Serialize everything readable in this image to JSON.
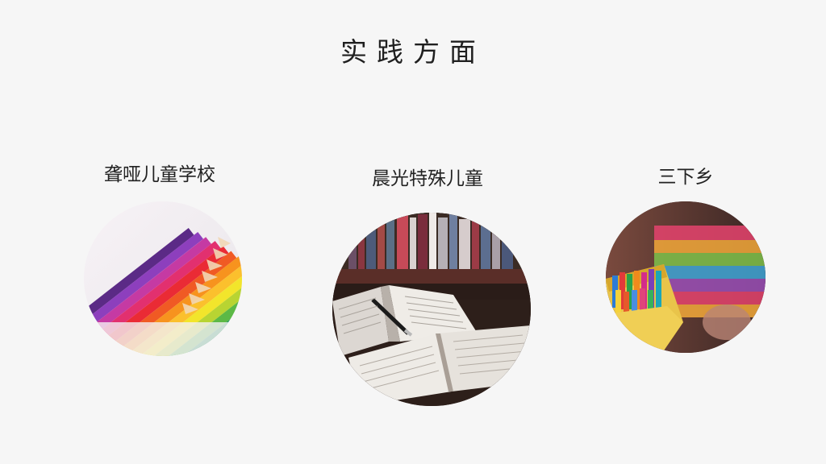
{
  "slide": {
    "title": "实践方面",
    "items": [
      {
        "label": "聋哑儿童学校",
        "image": "colored-pencils-photo"
      },
      {
        "label": "晨光特殊儿童",
        "image": "open-books-photo"
      },
      {
        "label": "三下乡",
        "image": "crayons-child-photo"
      }
    ]
  }
}
